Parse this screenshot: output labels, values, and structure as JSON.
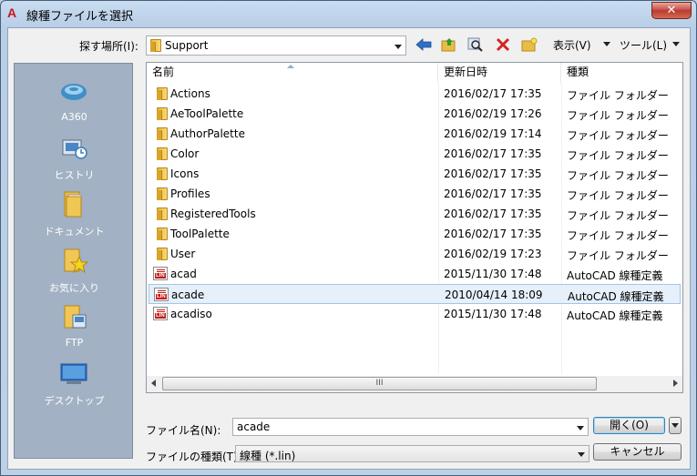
{
  "window": {
    "title": "線種ファイルを選択",
    "app_icon_glyph": "A",
    "close_glyph": "✕"
  },
  "toolbar": {
    "look_in_label": "探す場所(I):",
    "look_in_value": "Support",
    "back_icon": "back-arrow-icon",
    "up_folder_icon": "up-folder-icon",
    "search_web_icon": "search-web-icon",
    "delete_icon": "delete-icon",
    "new_folder_icon": "new-folder-icon",
    "views_label": "表示(V)",
    "tools_label": "ツール(L)"
  },
  "places": [
    {
      "label": "A360",
      "icon": "a360-icon"
    },
    {
      "label": "ヒストリ",
      "icon": "history-icon"
    },
    {
      "label": "ドキュメント",
      "icon": "documents-icon"
    },
    {
      "label": "お気に入り",
      "icon": "favorites-icon"
    },
    {
      "label": "FTP",
      "icon": "ftp-icon"
    },
    {
      "label": "デスクトップ",
      "icon": "desktop-icon"
    }
  ],
  "columns": {
    "name": "名前",
    "modified": "更新日時",
    "type": "種類"
  },
  "files": [
    {
      "name": "Actions",
      "modified": "2016/02/17 17:35",
      "type": "ファイル フォルダー",
      "kind": "folder"
    },
    {
      "name": "AeToolPalette",
      "modified": "2016/02/19 17:26",
      "type": "ファイル フォルダー",
      "kind": "folder"
    },
    {
      "name": "AuthorPalette",
      "modified": "2016/02/19 17:14",
      "type": "ファイル フォルダー",
      "kind": "folder"
    },
    {
      "name": "Color",
      "modified": "2016/02/17 17:35",
      "type": "ファイル フォルダー",
      "kind": "folder"
    },
    {
      "name": "Icons",
      "modified": "2016/02/17 17:35",
      "type": "ファイル フォルダー",
      "kind": "folder"
    },
    {
      "name": "Profiles",
      "modified": "2016/02/17 17:35",
      "type": "ファイル フォルダー",
      "kind": "folder"
    },
    {
      "name": "RegisteredTools",
      "modified": "2016/02/17 17:35",
      "type": "ファイル フォルダー",
      "kind": "folder"
    },
    {
      "name": "ToolPalette",
      "modified": "2016/02/17 17:35",
      "type": "ファイル フォルダー",
      "kind": "folder"
    },
    {
      "name": "User",
      "modified": "2016/02/19 17:23",
      "type": "ファイル フォルダー",
      "kind": "folder"
    },
    {
      "name": "acad",
      "modified": "2015/11/30 17:48",
      "type": "AutoCAD 線種定義",
      "kind": "lin"
    },
    {
      "name": "acade",
      "modified": "2010/04/14 18:09",
      "type": "AutoCAD 線種定義",
      "kind": "lin",
      "selected": true
    },
    {
      "name": "acadiso",
      "modified": "2015/11/30 17:48",
      "type": "AutoCAD 線種定義",
      "kind": "lin"
    }
  ],
  "scrollbar": {
    "thumb_grip": "III"
  },
  "bottom": {
    "filename_label": "ファイル名(N):",
    "filename_value": "acade",
    "filetype_label": "ファイルの種類(T):",
    "filetype_value": "線種 (*.lin)",
    "open_label": "開く(O)",
    "cancel_label": "キャンセル"
  }
}
